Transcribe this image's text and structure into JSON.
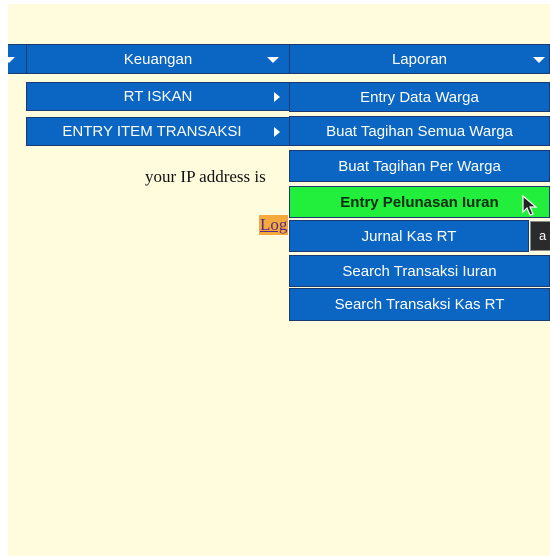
{
  "menubar": {
    "keuangan_label": "Keuangan",
    "laporan_label": "Laporan"
  },
  "keuangan_submenu": {
    "items": [
      {
        "label": "RT ISKAN"
      },
      {
        "label": "ENTRY ITEM TRANSAKSI"
      }
    ]
  },
  "laporan_submenu": {
    "items": [
      {
        "label": "Entry Data Warga"
      },
      {
        "label": "Buat Tagihan Semua Warga"
      },
      {
        "label": "Buat Tagihan Per Warga"
      },
      {
        "label": "Entry Pelunasan Iuran",
        "highlighted": true
      },
      {
        "label": "Jurnal Kas RT"
      },
      {
        "label": "Search Transaksi Iuran"
      },
      {
        "label": "Search Transaksi Kas RT"
      }
    ]
  },
  "content": {
    "ip_text": "your IP address is",
    "login_link": "Log"
  },
  "tooltip": {
    "text": "a"
  },
  "colors": {
    "menu_bg": "#0a66c2",
    "menu_highlight": "#22ee3c",
    "page_bg": "#fffbdd",
    "link_bg": "#f3a93b"
  },
  "icons": [
    "chevron-down-icon",
    "chevron-right-icon",
    "mouse-pointer-icon"
  ]
}
